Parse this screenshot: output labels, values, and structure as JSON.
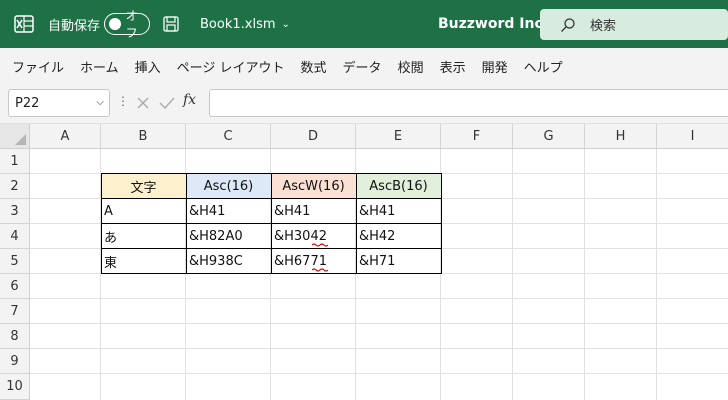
{
  "titlebar": {
    "autosave_label": "自動保存",
    "autosave_state": "オフ",
    "filename": "Book1.xlsm",
    "org": "Buzzword Inc.",
    "search_placeholder": "検索",
    "accent": "#1e7145"
  },
  "menu": {
    "items": [
      "ファイル",
      "ホーム",
      "挿入",
      "ページ レイアウト",
      "数式",
      "データ",
      "校閲",
      "表示",
      "開発",
      "ヘルプ"
    ]
  },
  "formula_bar": {
    "name_box": "P22",
    "fx_label": "fx",
    "formula": ""
  },
  "sheet": {
    "columns": [
      "A",
      "B",
      "C",
      "D",
      "E",
      "F",
      "G",
      "H",
      "I"
    ],
    "rows": [
      "1",
      "2",
      "3",
      "4",
      "5",
      "6",
      "7",
      "8",
      "9",
      "10"
    ],
    "table_headers": [
      "文字",
      "Asc(16)",
      "AscW(16)",
      "AscB(16)"
    ],
    "header_colors": [
      "#fdf0cc",
      "#dde9f7",
      "#fbe0d4",
      "#e2efda"
    ],
    "table_rows": [
      [
        "A",
        "&H41",
        "&H41",
        "&H41"
      ],
      [
        "あ",
        "&H82A0",
        "&H3042",
        "&H42"
      ],
      [
        "東",
        "&H938C",
        "&H6771",
        "&H71"
      ]
    ]
  }
}
